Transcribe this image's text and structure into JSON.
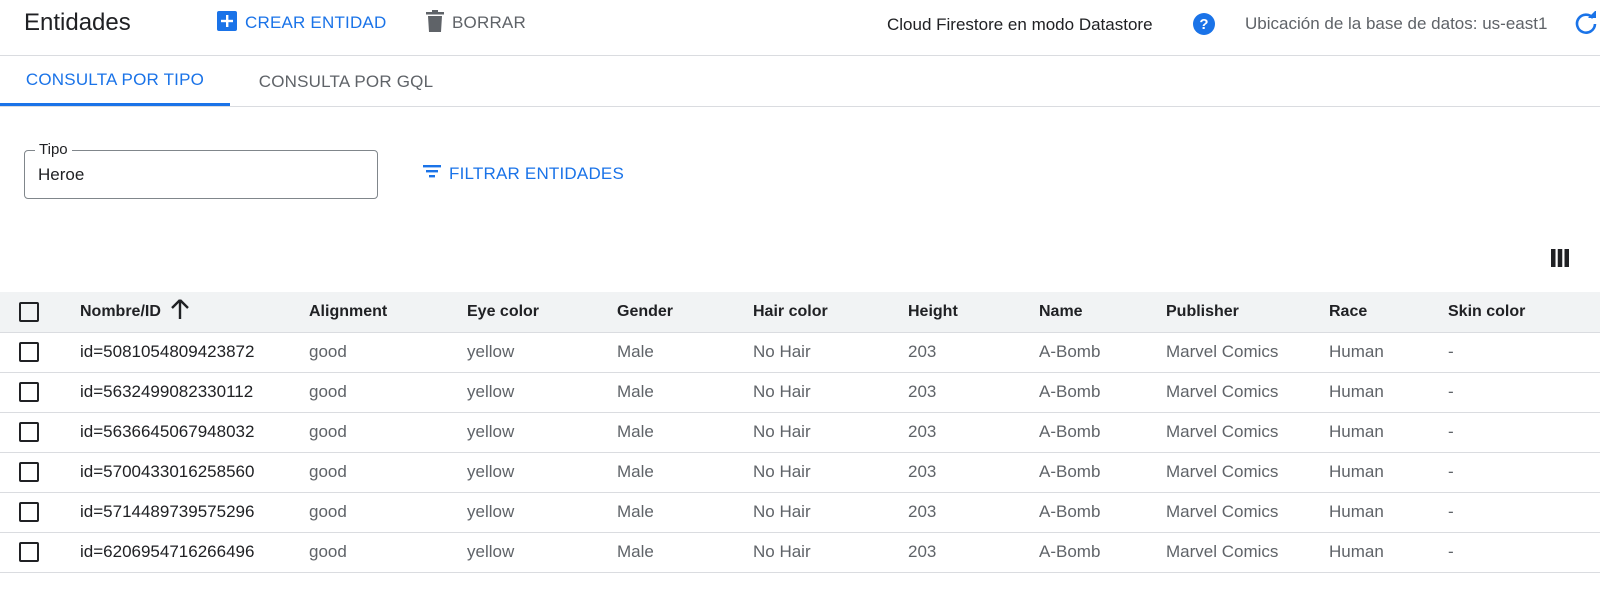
{
  "header": {
    "title": "Entidades",
    "create_label": "CREAR ENTIDAD",
    "delete_label": "BORRAR",
    "mode_text": "Cloud Firestore en modo Datastore",
    "location_text": "Ubicación de la base de datos: us-east1"
  },
  "tabs": [
    {
      "label": "CONSULTA POR TIPO",
      "active": true
    },
    {
      "label": "CONSULTA POR GQL",
      "active": false
    }
  ],
  "query": {
    "kind_label": "Tipo",
    "kind_value": "Heroe",
    "filter_label": "FILTRAR ENTIDADES"
  },
  "table": {
    "columns": [
      "Nombre/ID",
      "Alignment",
      "Eye color",
      "Gender",
      "Hair color",
      "Height",
      "Name",
      "Publisher",
      "Race",
      "Skin color"
    ],
    "rows": [
      [
        "id=5081054809423872",
        "good",
        "yellow",
        "Male",
        "No Hair",
        "203",
        "A-Bomb",
        "Marvel Comics",
        "Human",
        "-"
      ],
      [
        "id=5632499082330112",
        "good",
        "yellow",
        "Male",
        "No Hair",
        "203",
        "A-Bomb",
        "Marvel Comics",
        "Human",
        "-"
      ],
      [
        "id=5636645067948032",
        "good",
        "yellow",
        "Male",
        "No Hair",
        "203",
        "A-Bomb",
        "Marvel Comics",
        "Human",
        "-"
      ],
      [
        "id=5700433016258560",
        "good",
        "yellow",
        "Male",
        "No Hair",
        "203",
        "A-Bomb",
        "Marvel Comics",
        "Human",
        "-"
      ],
      [
        "id=5714489739575296",
        "good",
        "yellow",
        "Male",
        "No Hair",
        "203",
        "A-Bomb",
        "Marvel Comics",
        "Human",
        "-"
      ],
      [
        "id=6206954716266496",
        "good",
        "yellow",
        "Male",
        "No Hair",
        "203",
        "A-Bomb",
        "Marvel Comics",
        "Human",
        "-"
      ]
    ]
  },
  "icons": {
    "create": "add-box-icon",
    "delete": "trash-icon",
    "help": "help-icon",
    "refresh": "refresh-icon",
    "filter": "filter-icon",
    "columns": "columns-icon",
    "sort": "arrow-up-icon"
  },
  "colors": {
    "accent": "#1a73e8",
    "text": "#202124",
    "muted": "#5f6368",
    "header_bg": "#f1f3f4",
    "divider": "#dadce0"
  }
}
